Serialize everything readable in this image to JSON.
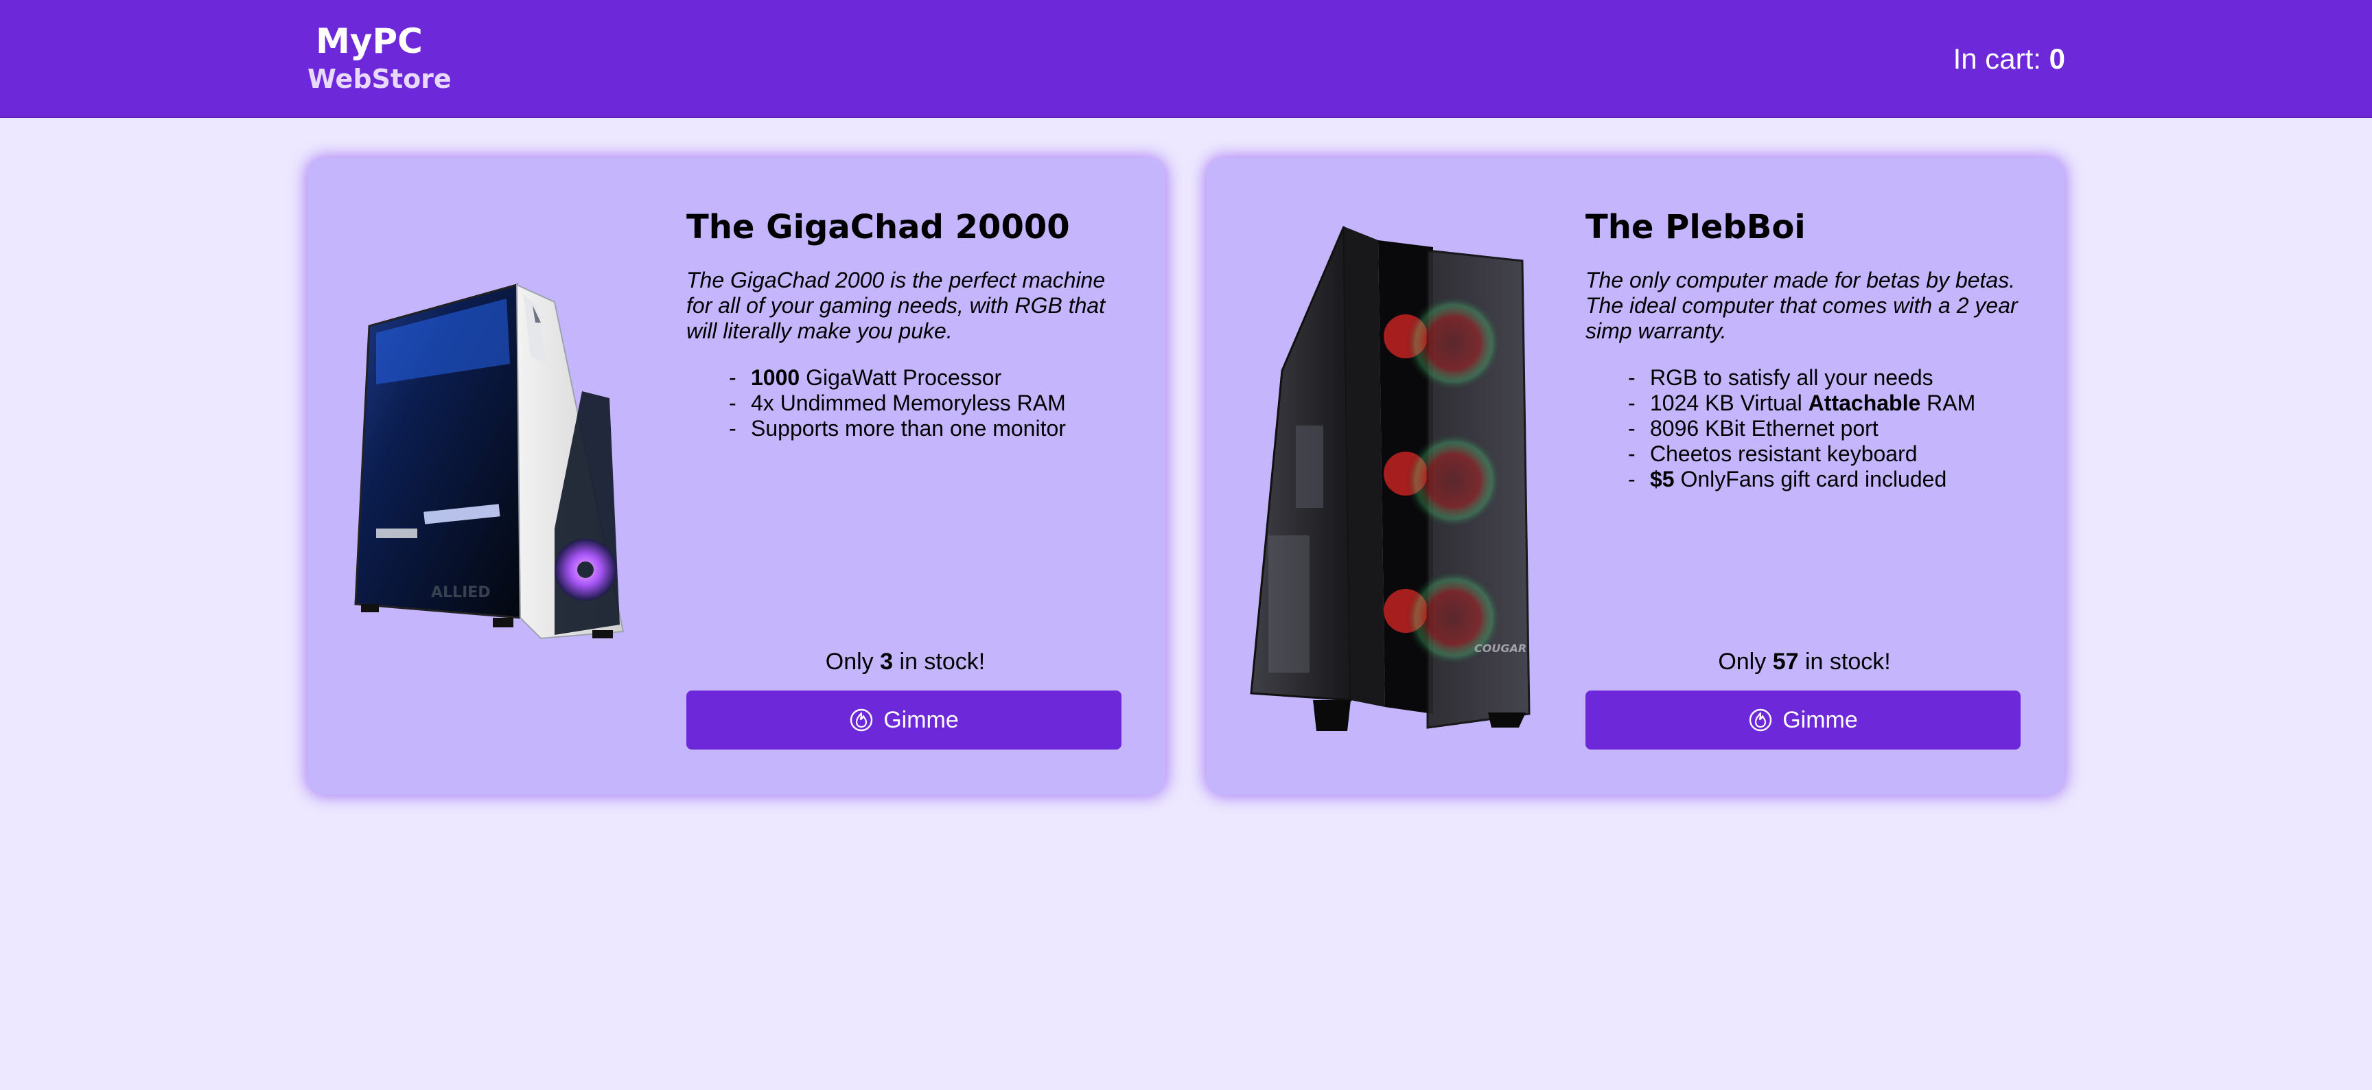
{
  "header": {
    "brand_line1": "MyPC",
    "brand_line2": "WebStore",
    "cart_label": "In cart:",
    "cart_count": "0"
  },
  "products": [
    {
      "title": "The GigaChad 20000",
      "description": "The GigaChad 2000 is the perfect machine for all of your gaming needs, with RGB that will literally make you puke.",
      "specs": [
        {
          "bold": "1000",
          "text": " GigaWatt Processor"
        },
        {
          "text": "4x Undimmed Memoryless RAM"
        },
        {
          "text": "Supports more than one monitor"
        }
      ],
      "stock_prefix": "Only",
      "stock_count": "3",
      "stock_suffix": "in stock!",
      "button_label": "Gimme",
      "image_brand": "ALLIED"
    },
    {
      "title": "The PlebBoi",
      "description": "The only computer made for betas by betas. The ideal computer that comes with a 2 year simp warranty.",
      "specs": [
        {
          "text": "RGB to satisfy all your needs"
        },
        {
          "text": "1024 KB Virtual ",
          "bold": "Attachable",
          "after": " RAM"
        },
        {
          "text": "8096 KBit Ethernet port"
        },
        {
          "text": "Cheetos resistant keyboard"
        },
        {
          "bold": "$5",
          "text": " OnlyFans gift card included"
        }
      ],
      "stock_prefix": "Only",
      "stock_count": "57",
      "stock_suffix": "in stock!",
      "button_label": "Gimme",
      "image_brand": "COUGAR"
    }
  ],
  "colors": {
    "header": "#6d28d9",
    "page_bg": "#ede8ff",
    "card_bg": "#c4b5fd",
    "button": "#6d28d9"
  },
  "icons": {
    "button_icon": "flame-icon"
  }
}
